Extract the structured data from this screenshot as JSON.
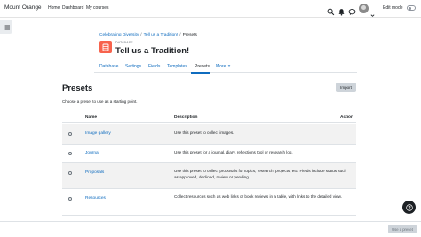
{
  "navbar": {
    "site_name": "Mount Orange",
    "links": [
      "Home",
      "Dashboard",
      "My courses"
    ],
    "edit_mode_label": "Edit mode"
  },
  "breadcrumb": [
    "Celebrating Diversity",
    "Tell us a Tradition!",
    "Presets"
  ],
  "header": {
    "module_type": "DATABASE",
    "title": "Tell us a Tradition!"
  },
  "secondary_nav": {
    "items": [
      "Database",
      "Settings",
      "Fields",
      "Templates",
      "Presets",
      "More"
    ],
    "active": "Presets"
  },
  "presets": {
    "heading": "Presets",
    "import_label": "Import",
    "hint": "Choose a preset to use as a starting point.",
    "columns": [
      "Name",
      "Description",
      "Action"
    ],
    "rows": [
      {
        "name": "Image gallery",
        "description": "Use this preset to collect images."
      },
      {
        "name": "Journal",
        "description": "Use this preset for a journal, diary, reflections tool or research log."
      },
      {
        "name": "Proposals",
        "description": "Use this preset to collect proposals for topics, research, projects, etc. Fields include status such as approved, declined, review or pending."
      },
      {
        "name": "Resources",
        "description": "Collect resources such as web links or book reviews in a table, with links to the detailed view."
      }
    ]
  },
  "footer": {
    "use_preset_label": "Use a preset"
  },
  "colors": {
    "link": "#0f6cbf",
    "module_icon": "#f7634d",
    "striped_row": "#f2f2f2"
  },
  "icons": [
    "drawer-icon",
    "search-icon",
    "bell-icon",
    "chat-icon",
    "chevron-down-icon",
    "database-icon",
    "question-icon"
  ]
}
